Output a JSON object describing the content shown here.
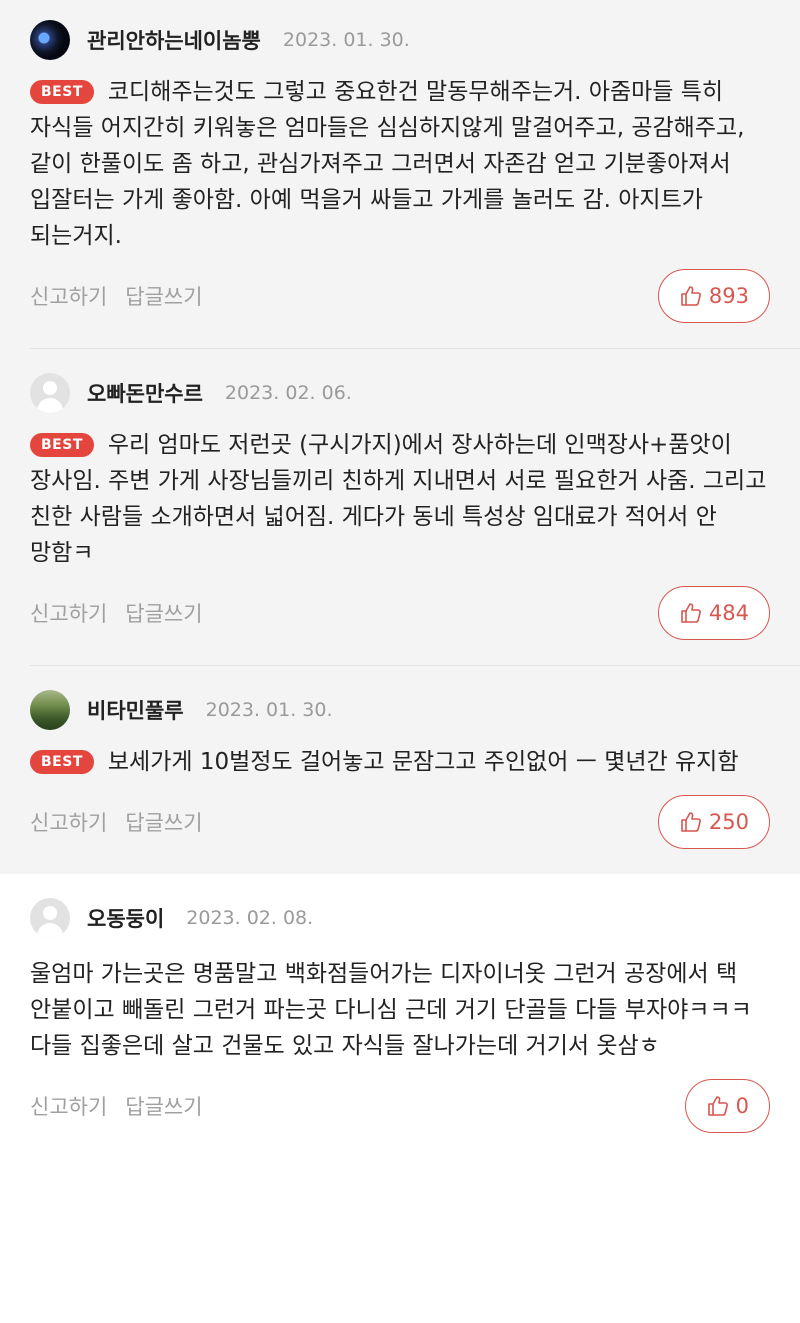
{
  "comments": [
    {
      "nickname": "관리안하는네이놈뿡",
      "date": "2023. 01. 30.",
      "best": "BEST",
      "text": "코디해주는것도 그렇고 중요한건 말동무해주는거. 아줌마들 특히 자식들 어지간히 키워놓은 엄마들은 심심하지않게 말걸어주고, 공감해주고, 같이 한풀이도 좀 하고, 관심가져주고 그러면서 자존감 얻고 기분좋아져서 입잘터는 가게 좋아함. 아예 먹을거 싸들고 가게를 놀러도 감. 아지트가 되는거지.",
      "report": "신고하기",
      "reply": "답글쓰기",
      "likes": "893",
      "avatar": "space-avatar"
    },
    {
      "nickname": "오빠돈만수르",
      "date": "2023. 02. 06.",
      "best": "BEST",
      "text": "우리 엄마도 저런곳 (구시가지)에서 장사하는데 인맥장사+품앗이 장사임. 주변 가게 사장님들끼리 친하게 지내면서 서로 필요한거 사줌. 그리고 친한 사람들 소개하면서 넓어짐. 게다가 동네 특성상 임대료가 적어서 안 망함ㅋ",
      "report": "신고하기",
      "reply": "답글쓰기",
      "likes": "484",
      "avatar": "default-avatar"
    },
    {
      "nickname": "비타민풀루",
      "date": "2023. 01. 30.",
      "best": "BEST",
      "text": "보세가게 10벌정도 걸어놓고 문잠그고 주인없어 ㅡ 몇년간 유지함",
      "report": "신고하기",
      "reply": "답글쓰기",
      "likes": "250",
      "avatar": "landscape-avatar"
    },
    {
      "nickname": "오동둥이",
      "date": "2023. 02. 08.",
      "text": "울엄마 가는곳은 명품말고 백화점들어가는 디자이너옷 그런거 공장에서 택 안붙이고 빼돌린 그런거 파는곳 다니심 근데 거기 단골들 다들 부자야ㅋㅋㅋ 다들 집좋은데 살고 건물도 있고 자식들 잘나가는데 거기서 옷삼ㅎ",
      "report": "신고하기",
      "reply": "답글쓰기",
      "likes": "0",
      "avatar": "default-avatar"
    }
  ],
  "colors": {
    "best_bg": "#f4f4f4",
    "badge": "#e4463e",
    "like_accent": "#d7574f"
  }
}
